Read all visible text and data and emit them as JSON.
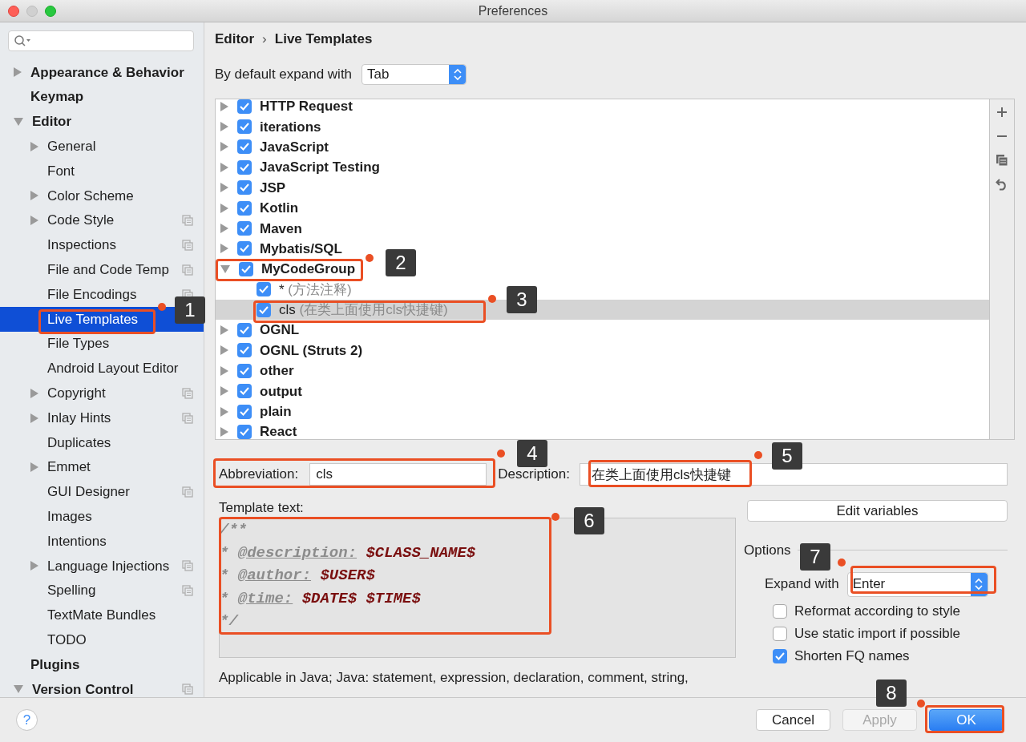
{
  "window": {
    "title": "Preferences"
  },
  "sidebar": {
    "items": [
      {
        "label": "Appearance & Behavior",
        "expanded": false,
        "selected": false
      },
      {
        "label": "Keymap",
        "selected": false
      },
      {
        "label": "Editor",
        "expanded": true,
        "selected": false,
        "children": [
          {
            "label": "General",
            "expanded": false,
            "selected": false
          },
          {
            "label": "Font",
            "selected": false
          },
          {
            "label": "Color Scheme",
            "expanded": false,
            "selected": false
          },
          {
            "label": "Code Style",
            "expanded": false,
            "project_scoped": true,
            "selected": false
          },
          {
            "label": "Inspections",
            "project_scoped": true,
            "selected": false
          },
          {
            "label": "File and Code Temp",
            "project_scoped": true,
            "selected": false
          },
          {
            "label": "File Encodings",
            "project_scoped": true,
            "selected": false
          },
          {
            "label": "Live Templates",
            "selected": true
          },
          {
            "label": "File Types",
            "selected": false
          },
          {
            "label": "Android Layout Editor",
            "selected": false
          },
          {
            "label": "Copyright",
            "expanded": false,
            "project_scoped": true,
            "selected": false
          },
          {
            "label": "Inlay Hints",
            "expanded": false,
            "project_scoped": true,
            "selected": false
          },
          {
            "label": "Duplicates",
            "selected": false
          },
          {
            "label": "Emmet",
            "expanded": false,
            "selected": false
          },
          {
            "label": "GUI Designer",
            "project_scoped": true,
            "selected": false
          },
          {
            "label": "Images",
            "selected": false
          },
          {
            "label": "Intentions",
            "selected": false
          },
          {
            "label": "Language Injections",
            "expanded": false,
            "project_scoped": true,
            "selected": false
          },
          {
            "label": "Spelling",
            "project_scoped": true,
            "selected": false
          },
          {
            "label": "TextMate Bundles",
            "selected": false
          },
          {
            "label": "TODO",
            "selected": false
          }
        ]
      },
      {
        "label": "Plugins",
        "selected": false
      },
      {
        "label": "Version Control",
        "expanded": true,
        "project_scoped": true,
        "selected": false
      }
    ]
  },
  "breadcrumb": [
    "Editor",
    "›",
    "Live Templates"
  ],
  "default_expand": {
    "label": "By default expand with",
    "value": "Tab"
  },
  "templates": [
    {
      "name": "HTTP Request",
      "checked": true,
      "expanded": false,
      "selected": false
    },
    {
      "name": "iterations",
      "checked": true,
      "expanded": false,
      "selected": false
    },
    {
      "name": "JavaScript",
      "checked": true,
      "expanded": false,
      "selected": false
    },
    {
      "name": "JavaScript Testing",
      "checked": true,
      "expanded": false,
      "selected": false
    },
    {
      "name": "JSP",
      "checked": true,
      "expanded": false,
      "selected": false
    },
    {
      "name": "Kotlin",
      "checked": true,
      "expanded": false,
      "selected": false
    },
    {
      "name": "Maven",
      "checked": true,
      "expanded": false,
      "selected": false
    },
    {
      "name": "Mybatis/SQL",
      "checked": true,
      "expanded": false,
      "selected": false
    },
    {
      "name": "MyCodeGroup",
      "checked": true,
      "expanded": true,
      "selected": false,
      "children": [
        {
          "name": "*",
          "description": "(方法注释)",
          "checked": true,
          "selected": false
        },
        {
          "name": "cls",
          "description": "(在类上面使用cls快捷键)",
          "checked": true,
          "selected": true
        }
      ]
    },
    {
      "name": "OGNL",
      "checked": true,
      "expanded": false,
      "selected": false
    },
    {
      "name": "OGNL (Struts 2)",
      "checked": true,
      "expanded": false,
      "selected": false
    },
    {
      "name": "other",
      "checked": true,
      "expanded": false,
      "selected": false
    },
    {
      "name": "output",
      "checked": true,
      "expanded": false,
      "selected": false
    },
    {
      "name": "plain",
      "checked": true,
      "expanded": false,
      "selected": false
    },
    {
      "name": "React",
      "checked": true,
      "expanded": false,
      "selected": false
    }
  ],
  "abbreviation": {
    "label": "Abbreviation:",
    "value": "cls"
  },
  "description": {
    "label": "Description:",
    "value": "在类上面使用cls快捷键"
  },
  "template_text": {
    "label": "Template text:",
    "lines": [
      [
        {
          "kind": "comment",
          "text": "/**"
        }
      ],
      [
        {
          "kind": "comment",
          "text": "* "
        },
        {
          "kind": "tag",
          "text": "@description:"
        },
        {
          "kind": "variable",
          "text": " $CLASS_NAME$"
        }
      ],
      [
        {
          "kind": "comment",
          "text": "* "
        },
        {
          "kind": "tag",
          "text": "@author:"
        },
        {
          "kind": "variable",
          "text": " $USER$"
        }
      ],
      [
        {
          "kind": "comment",
          "text": "* "
        },
        {
          "kind": "tag",
          "text": "@time:"
        },
        {
          "kind": "variable",
          "text": " $DATE$ $TIME$"
        }
      ],
      [
        {
          "kind": "comment",
          "text": "*/"
        }
      ]
    ]
  },
  "applicable": "Applicable in Java; Java: statement, expression, declaration, comment, string,",
  "edit_variables": "Edit variables",
  "options": {
    "title": "Options",
    "expand_with": {
      "label": "Expand with",
      "value": "Enter"
    },
    "checkboxes": [
      {
        "label": "Reformat according to style",
        "checked": false
      },
      {
        "label": "Use static import if possible",
        "checked": false
      },
      {
        "label": "Shorten FQ names",
        "checked": true
      }
    ]
  },
  "footer": {
    "help": "?",
    "buttons": [
      {
        "label": "Cancel",
        "kind": "normal"
      },
      {
        "label": "Apply",
        "kind": "disabled"
      },
      {
        "label": "OK",
        "kind": "default"
      }
    ]
  },
  "annotations": [
    {
      "label": "1"
    },
    {
      "label": "2"
    },
    {
      "label": "3"
    },
    {
      "label": "4"
    },
    {
      "label": "5"
    },
    {
      "label": "6"
    },
    {
      "label": "7"
    },
    {
      "label": "8"
    }
  ]
}
